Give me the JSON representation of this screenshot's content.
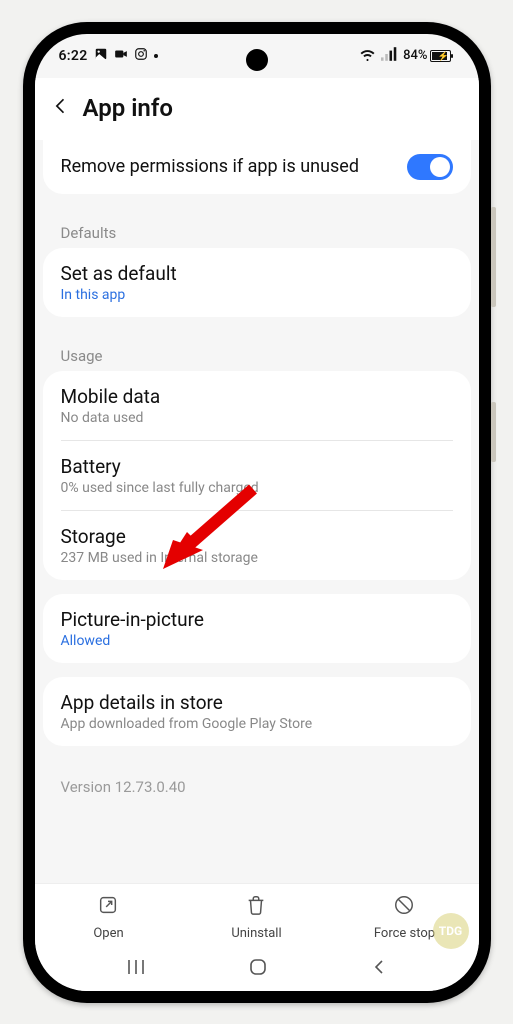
{
  "status": {
    "time": "6:22",
    "battery_text": "84%"
  },
  "header": {
    "title": "App info"
  },
  "top_card": {
    "remove_permissions_label": "Remove permissions if app is unused"
  },
  "sections": {
    "defaults_header": "Defaults",
    "set_as_default": {
      "title": "Set as default",
      "sub": "In this app"
    },
    "usage_header": "Usage",
    "mobile_data": {
      "title": "Mobile data",
      "sub": "No data used"
    },
    "battery": {
      "title": "Battery",
      "sub": "0% used since last fully charged"
    },
    "storage": {
      "title": "Storage",
      "sub": "237 MB used in Internal storage"
    },
    "pip": {
      "title": "Picture-in-picture",
      "sub": "Allowed"
    },
    "app_details": {
      "title": "App details in store",
      "sub": "App downloaded from Google Play Store"
    }
  },
  "version_text": "Version 12.73.0.40",
  "actions": {
    "open": "Open",
    "uninstall": "Uninstall",
    "force_stop": "Force stop"
  },
  "watermark": "TDG"
}
